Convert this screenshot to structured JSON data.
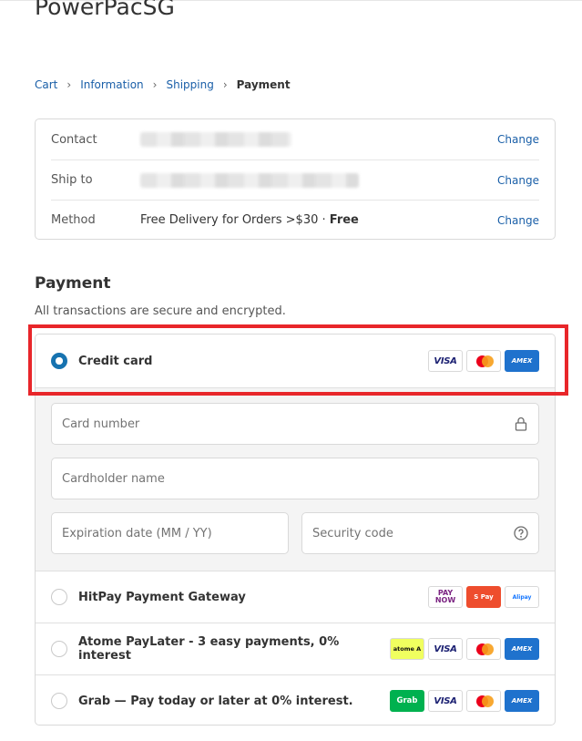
{
  "store": {
    "title": "PowerPacSG"
  },
  "breadcrumb": {
    "items": [
      {
        "label": "Cart"
      },
      {
        "label": "Information"
      },
      {
        "label": "Shipping"
      }
    ],
    "current": "Payment",
    "separator": "›"
  },
  "review": {
    "rows": [
      {
        "label": "Contact",
        "value": "",
        "change": "Change"
      },
      {
        "label": "Ship to",
        "value": "",
        "change": "Change"
      },
      {
        "label": "Method",
        "value": "Free Delivery for Orders >$30 · ",
        "value_strong": "Free",
        "change": "Change"
      }
    ]
  },
  "payment": {
    "title": "Payment",
    "subtitle": "All transactions are secure and encrypted.",
    "options": [
      {
        "label": "Credit card",
        "selected": true,
        "badges": [
          "visa",
          "mastercard",
          "amex"
        ]
      },
      {
        "label": "HitPay Payment Gateway",
        "selected": false,
        "badges": [
          "paynow",
          "shopeepay",
          "alipay"
        ]
      },
      {
        "label": "Atome PayLater - 3 easy payments, 0% interest",
        "selected": false,
        "badges": [
          "atome",
          "visa",
          "mastercard",
          "amex"
        ]
      },
      {
        "label": "Grab — Pay today or later at 0% interest.",
        "selected": false,
        "badges": [
          "grab",
          "visa",
          "mastercard",
          "amex"
        ]
      }
    ],
    "card_form": {
      "card_number_placeholder": "Card number",
      "cardholder_placeholder": "Cardholder name",
      "expiry_placeholder": "Expiration date (MM / YY)",
      "security_placeholder": "Security code"
    },
    "badge_text": {
      "visa": "VISA",
      "amex": "AMEX",
      "paynow_top": "PAY",
      "paynow_bottom": "NOW",
      "shopeepay": "S Pay",
      "alipay": "Alipay",
      "atome": "atome A",
      "grab": "Grab"
    }
  },
  "colors": {
    "link": "#1a5fa8",
    "accent": "#1773b0",
    "highlight": "#e8262a"
  }
}
